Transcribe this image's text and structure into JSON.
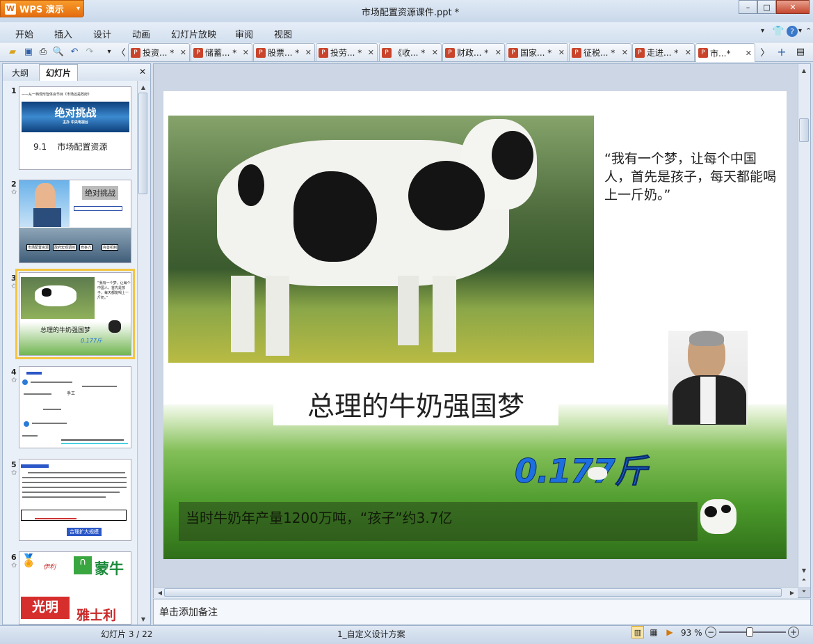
{
  "app": {
    "logo_label": "WPS 演示",
    "doc_title": "市场配置资源课件.ppt *"
  },
  "window_controls": {
    "minimize": "–",
    "maximize": "□",
    "close": "✕"
  },
  "menu": [
    "开始",
    "插入",
    "设计",
    "动画",
    "幻灯片放映",
    "审阅",
    "视图"
  ],
  "tabs": [
    {
      "label": "投资... *"
    },
    {
      "label": "储蓄... *"
    },
    {
      "label": "股票... *"
    },
    {
      "label": "投劳... *"
    },
    {
      "label": "《收... *"
    },
    {
      "label": "财政... *"
    },
    {
      "label": "国家... *"
    },
    {
      "label": "征税... *"
    },
    {
      "label": "走进... *"
    },
    {
      "label": "市...*"
    }
  ],
  "panel": {
    "tab_outline": "大纲",
    "tab_slides": "幻灯片",
    "close": "✕"
  },
  "thumbnails": [
    {
      "num": "1",
      "line1": "——从一档现形智体会节目《市场还是政府》",
      "banner": "绝对挑战",
      "banner_sub": "主办  中央电视台",
      "title": "9.1    市场配置资源"
    },
    {
      "num": "2",
      "star": "✩",
      "banner": "绝对挑战",
      "chips": [
        "市场配置资源",
        "政府宏观调控",
        "竞争力",
        "完善机制"
      ]
    },
    {
      "num": "3",
      "star": "✩",
      "quote": "“我有一个梦，让每个中国人，首先是孩子，每天都能喝上一斤奶。”",
      "title": "总理的牛奶强国梦",
      "num_art": "0.177斤"
    },
    {
      "num": "4",
      "star": "✩",
      "text": "手工"
    },
    {
      "num": "5",
      "star": "✩",
      "text": "合理扩大规模"
    },
    {
      "num": "6",
      "star": "✩",
      "brands": [
        "伊利",
        "蒙牛",
        "光明",
        "雅士利"
      ]
    }
  ],
  "slide": {
    "quote": "“我有一个梦，让每个中国人，首先是孩子，每天都能喝上一斤奶。”",
    "title": "总理的牛奶强国梦",
    "num_art": "0.177斤",
    "bottom_text": "当时牛奶年产量1200万吨，“孩子”约3.7亿"
  },
  "notes_placeholder": "单击添加备注",
  "status": {
    "slide_counter": "幻灯片 3 / 22",
    "design": "1_自定义设计方案",
    "zoom": "93 %"
  },
  "colors": {
    "accent": "#e46d10",
    "chrome": "#d6e0ec",
    "selected_thumb": "#f4c542"
  }
}
